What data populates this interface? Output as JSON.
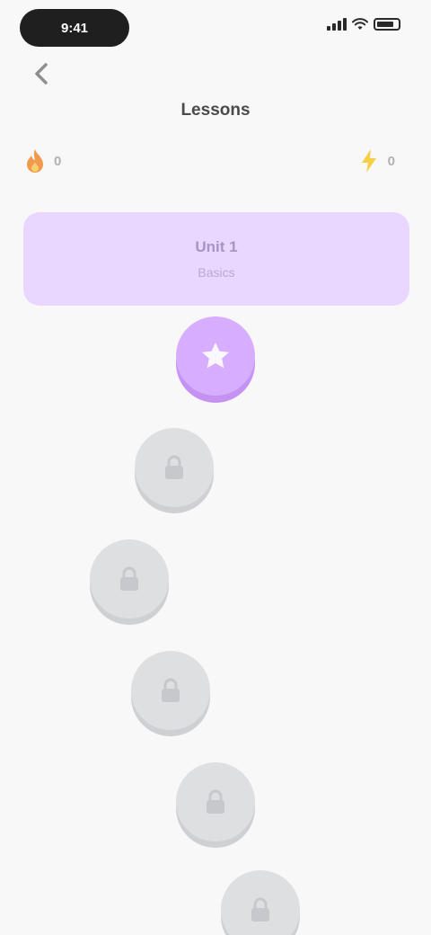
{
  "status_bar": {
    "time": "9:41"
  },
  "header": {
    "title": "Lessons",
    "back_icon": "chevron-left-icon"
  },
  "stats": {
    "streak": {
      "icon": "flame-icon",
      "value": "0"
    },
    "points": {
      "icon": "lightning-icon",
      "value": "0"
    }
  },
  "unit": {
    "title": "Unit 1",
    "subtitle": "Basics"
  },
  "path": [
    {
      "state": "active",
      "icon": "star-icon"
    },
    {
      "state": "locked",
      "icon": "lock-icon"
    },
    {
      "state": "locked",
      "icon": "lock-icon"
    },
    {
      "state": "locked",
      "icon": "lock-icon"
    },
    {
      "state": "locked",
      "icon": "lock-icon"
    },
    {
      "state": "locked",
      "icon": "lock-icon"
    }
  ],
  "colors": {
    "accent": "#d7adff",
    "banner": "#ead7ff",
    "locked": "#dedfe1",
    "background": "#f8f8f9"
  }
}
